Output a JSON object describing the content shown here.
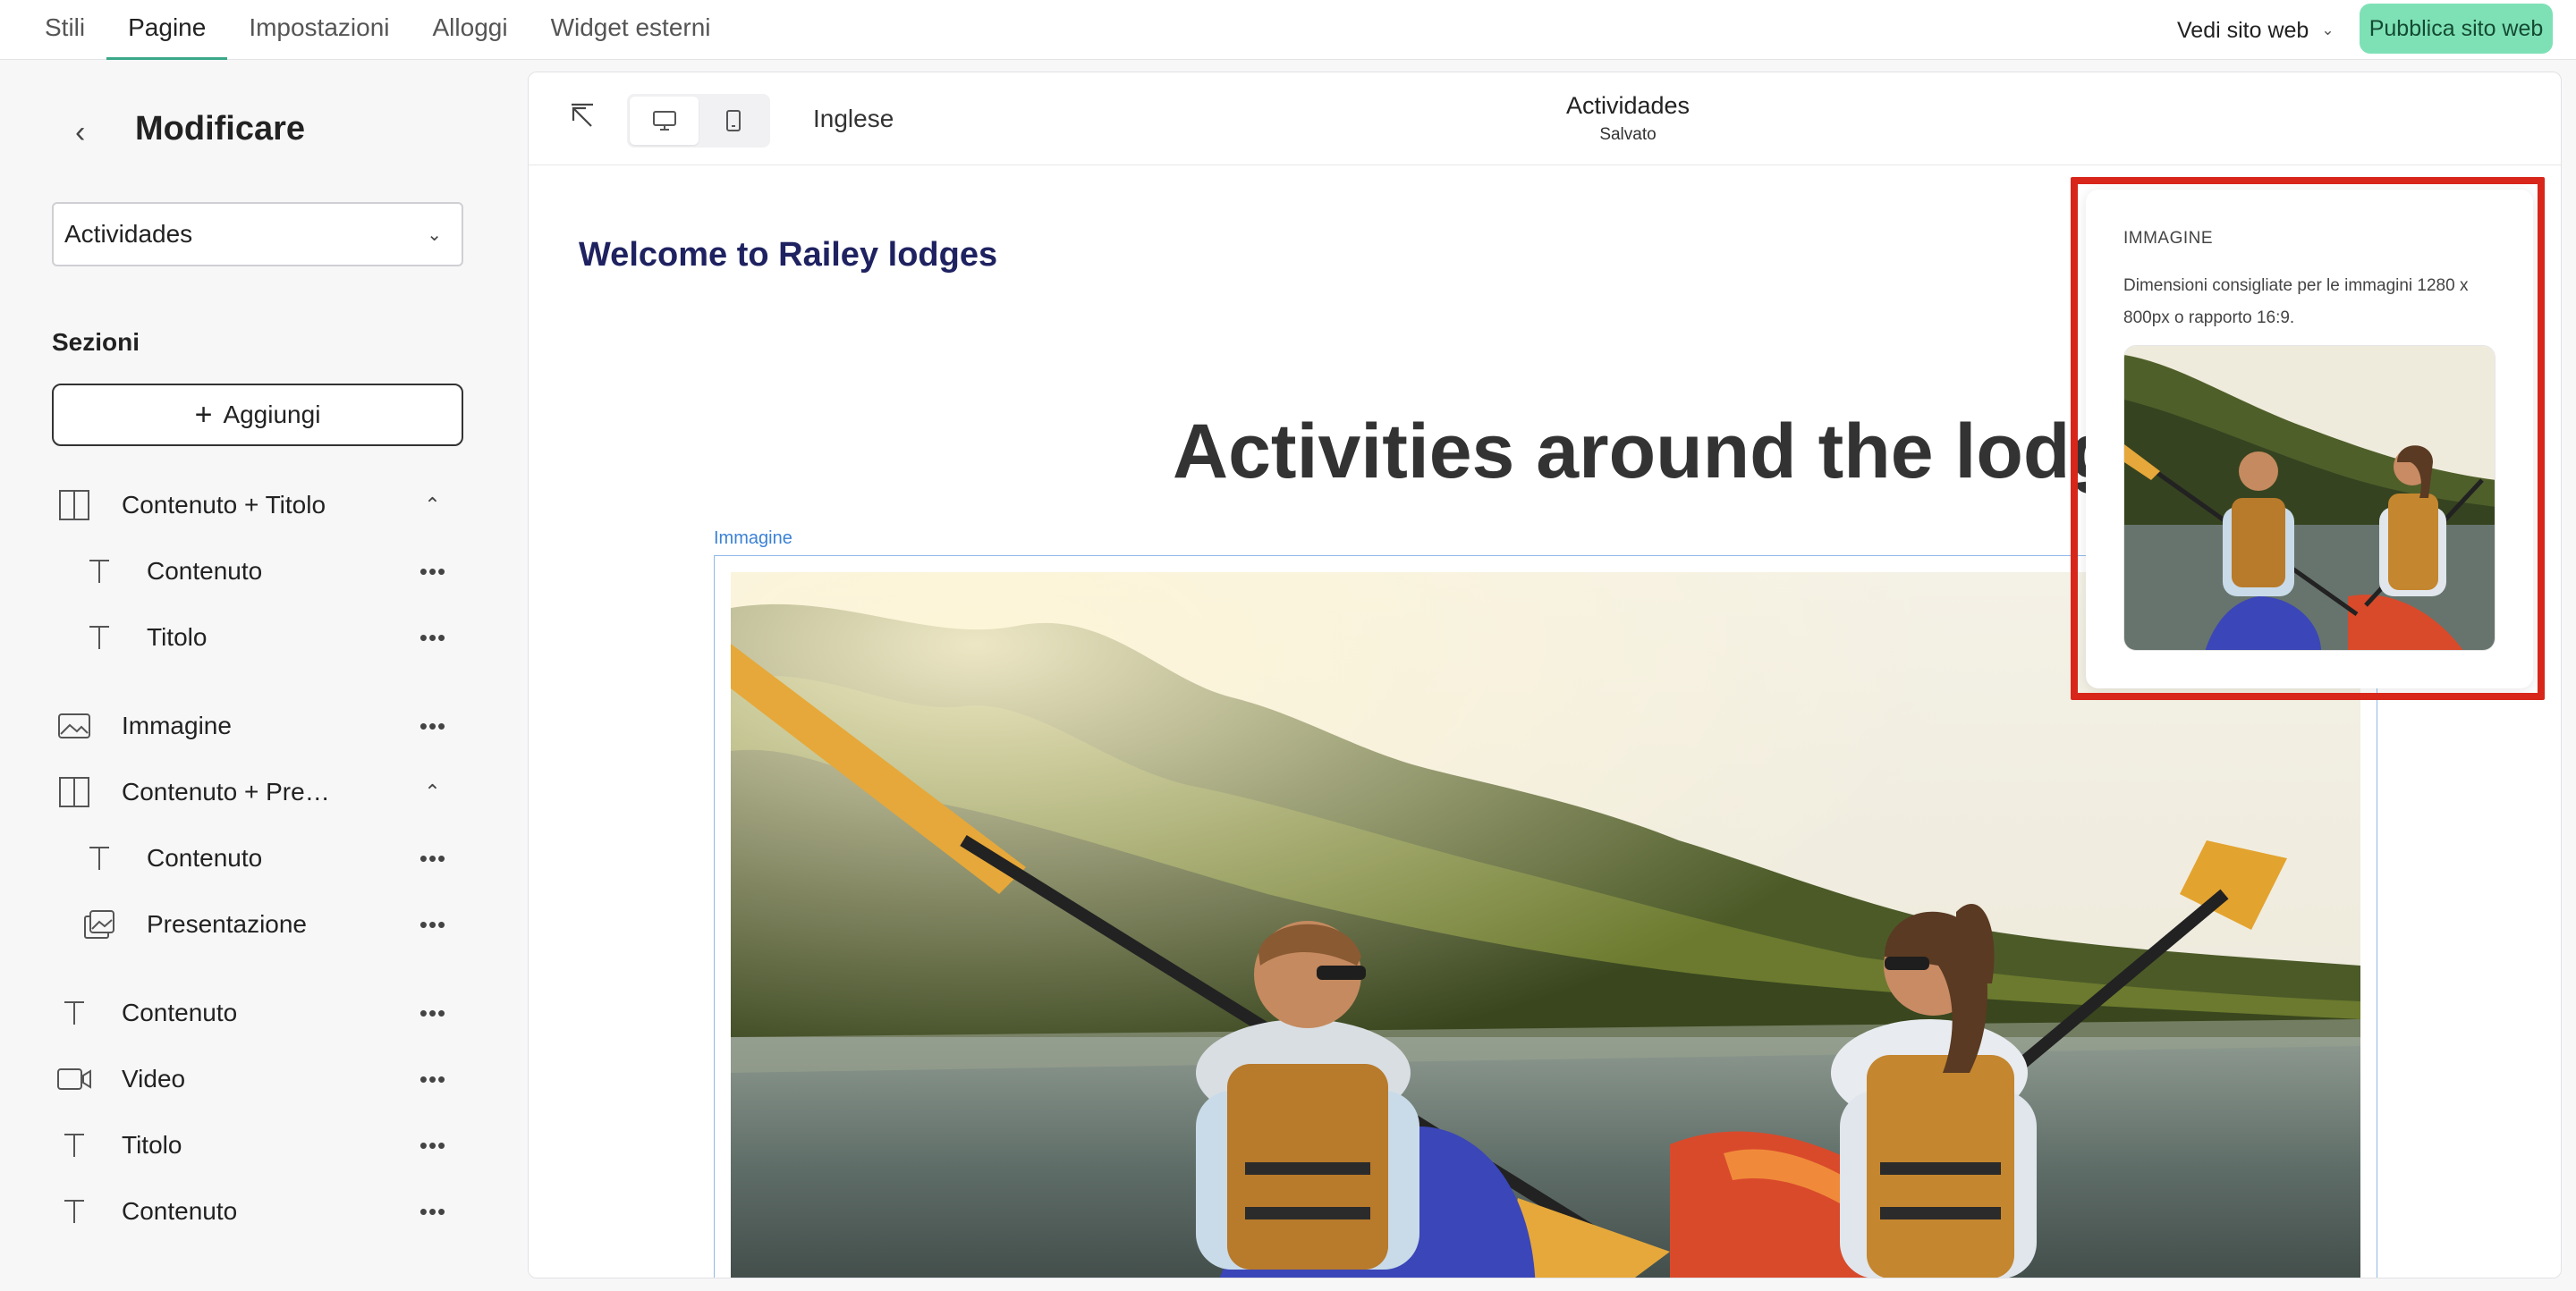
{
  "topnav": {
    "tabs": [
      {
        "label": "Stili"
      },
      {
        "label": "Pagine"
      },
      {
        "label": "Impostazioni"
      },
      {
        "label": "Alloggi"
      },
      {
        "label": "Widget esterni"
      }
    ],
    "active_tab": "Pagine",
    "view_site_label": "Vedi sito web",
    "publish_label": "Pubblica sito web"
  },
  "sidebar": {
    "title": "Modificare",
    "page_select_value": "Actividades",
    "sections_label": "Sezioni",
    "add_label": "Aggiungi",
    "items": [
      {
        "label": "Contenuto + Titolo",
        "icon": "columns-icon",
        "level": 0,
        "action": "caret-up"
      },
      {
        "label": "Contenuto",
        "icon": "text-icon",
        "level": 1,
        "action": "more"
      },
      {
        "label": "Titolo",
        "icon": "text-icon",
        "level": 1,
        "action": "more"
      },
      {
        "label": "Immagine",
        "icon": "image-icon",
        "level": 0,
        "action": "more"
      },
      {
        "label": "Contenuto + Pre…",
        "icon": "columns-icon",
        "level": 0,
        "action": "caret-up"
      },
      {
        "label": "Contenuto",
        "icon": "text-icon",
        "level": 1,
        "action": "more"
      },
      {
        "label": "Presentazione",
        "icon": "slideshow-icon",
        "level": 1,
        "action": "more"
      },
      {
        "label": "Contenuto",
        "icon": "text-icon",
        "level": 0,
        "action": "more"
      },
      {
        "label": "Video",
        "icon": "video-icon",
        "level": 0,
        "action": "more"
      },
      {
        "label": "Titolo",
        "icon": "text-icon",
        "level": 0,
        "action": "more"
      },
      {
        "label": "Contenuto",
        "icon": "text-icon",
        "level": 0,
        "action": "more"
      }
    ]
  },
  "editor": {
    "language": "Inglese",
    "page_title": "Actividades",
    "save_status": "Salvato",
    "welcome": "Welcome to Railey lodges",
    "heading": "Activities around the lodges",
    "image_caption": "Immagine"
  },
  "popover": {
    "title": "IMMAGINE",
    "description": "Dimensioni consigliate per le immagini 1280 x 800px o rapporto 16:9."
  },
  "colors": {
    "accent_green": "#3aa888",
    "publish_bg": "#7ee1b5",
    "welcome_navy": "#1f2260",
    "selection_blue": "#3b82d6",
    "highlight_red": "#d8261b"
  }
}
